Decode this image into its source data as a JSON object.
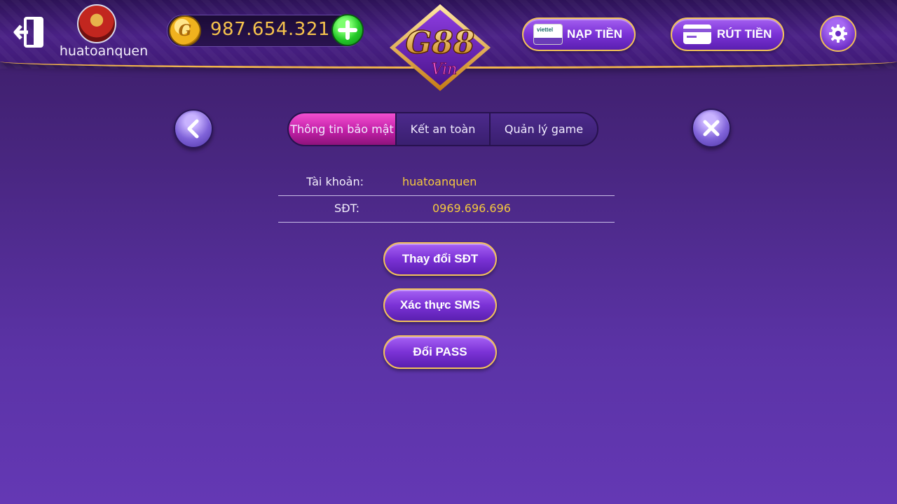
{
  "header": {
    "username": "huatoanquen",
    "balance": "987.654.321",
    "coin_letter": "G",
    "logo_text": "G88",
    "logo_subtext": "Vin",
    "nap_label": "NẠP TIỀN",
    "nap_icon_text": "viettel",
    "rut_label": "RÚT TIỀN"
  },
  "tabs": [
    {
      "label": "Thông tin bảo mật",
      "active": true
    },
    {
      "label": "Kết an toàn",
      "active": false
    },
    {
      "label": "Quản lý game",
      "active": false
    }
  ],
  "info": {
    "account_label": "Tài khoản:",
    "account_value": "huatoanquen",
    "phone_label": "SĐT:",
    "phone_value": "0969.696.696"
  },
  "actions": {
    "change_phone": "Thay đổi SĐT",
    "verify_sms": "Xác thực SMS",
    "change_pass": "Đổi PASS"
  },
  "colors": {
    "accent_gold": "#f6c34d",
    "active_tab": "#e040c0",
    "button_purple": "#7b32d6"
  }
}
